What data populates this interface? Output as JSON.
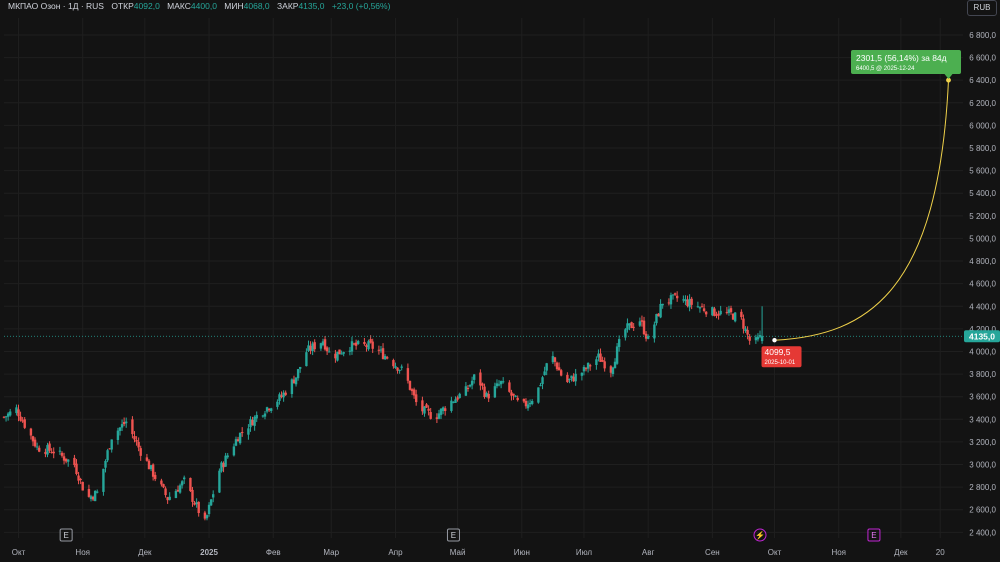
{
  "header": {
    "symbol": "МКПАО Озон · 1Д · RUS",
    "open_label": "ОТКР",
    "open_value": "4092,0",
    "high_label": "МАКС",
    "high_value": "4400,0",
    "low_label": "МИН",
    "low_value": "4068,0",
    "close_label": "ЗАКР",
    "close_value": "4135,0",
    "change": "+23,0 (+0,56%)"
  },
  "currency_button": "RUB",
  "current_price_label": "4135,0",
  "projection": {
    "start_label": "4099,5",
    "start_date": "2025-10-01",
    "target_label": "2301,5 (56,14%) за 84д",
    "target_sub": "6400,5 @ 2025-12-24"
  },
  "event_markers": [
    {
      "label": "E",
      "x": "2024-10-24"
    },
    {
      "label": "E",
      "x": "2025-04-29"
    },
    {
      "label": "⚡",
      "x": "2025-09-24"
    },
    {
      "label": "E",
      "x": "2025-11-18"
    }
  ],
  "colors": {
    "background": "#131313",
    "up": "#26a69a",
    "down": "#ef5350",
    "projection_line": "#f0d24a",
    "target_badge": "#4caf50",
    "start_badge": "#e53935",
    "price_line": "#26a69a"
  },
  "chart_data": {
    "type": "candlestick",
    "title": "МКПАО Озон · 1Д · RUS",
    "y_unit": "RUB",
    "ylim": [
      2350,
      6950
    ],
    "xlim": [
      "2024-09-24",
      "2025-12-31"
    ],
    "y_ticks": [
      "2 400,0",
      "2 600,0",
      "2 800,0",
      "3 000,0",
      "3 200,0",
      "3 400,0",
      "3 600,0",
      "3 800,0",
      "4 000,0",
      "4 200,0",
      "4 400,0",
      "4 600,0",
      "4 800,0",
      "5 000,0",
      "5 200,0",
      "5 400,0",
      "5 600,0",
      "5 800,0",
      "6 000,0",
      "6 200,0",
      "6 400,0",
      "6 600,0",
      "6 800,0"
    ],
    "x_ticks": [
      {
        "label": "Окт",
        "date": "2024-10-01"
      },
      {
        "label": "Ноя",
        "date": "2024-11-01"
      },
      {
        "label": "Дек",
        "date": "2024-12-01"
      },
      {
        "label": "2025",
        "date": "2025-01-01"
      },
      {
        "label": "Фев",
        "date": "2025-02-01"
      },
      {
        "label": "Мар",
        "date": "2025-03-01"
      },
      {
        "label": "Апр",
        "date": "2025-04-01"
      },
      {
        "label": "Май",
        "date": "2025-05-01"
      },
      {
        "label": "Июн",
        "date": "2025-06-01"
      },
      {
        "label": "Июл",
        "date": "2025-07-01"
      },
      {
        "label": "Авг",
        "date": "2025-08-01"
      },
      {
        "label": "Сен",
        "date": "2025-09-01"
      },
      {
        "label": "Окт",
        "date": "2025-10-01"
      },
      {
        "label": "Ноя",
        "date": "2025-11-01"
      },
      {
        "label": "Дек",
        "date": "2025-12-01"
      },
      {
        "label": "20",
        "date": "2025-12-20"
      }
    ],
    "anchors": [
      {
        "date": "2024-09-24",
        "close": 3420
      },
      {
        "date": "2024-09-30",
        "close": 3490
      },
      {
        "date": "2024-10-10",
        "close": 3150
      },
      {
        "date": "2024-10-18",
        "close": 3120
      },
      {
        "date": "2024-10-28",
        "close": 3000
      },
      {
        "date": "2024-11-03",
        "close": 2700
      },
      {
        "date": "2024-11-08",
        "close": 2750
      },
      {
        "date": "2024-11-15",
        "close": 3250
      },
      {
        "date": "2024-11-22",
        "close": 3380
      },
      {
        "date": "2024-11-28",
        "close": 3150
      },
      {
        "date": "2024-12-05",
        "close": 2920
      },
      {
        "date": "2024-12-12",
        "close": 2700
      },
      {
        "date": "2024-12-20",
        "close": 2850
      },
      {
        "date": "2024-12-30",
        "close": 2480
      },
      {
        "date": "2025-01-06",
        "close": 2950
      },
      {
        "date": "2025-01-15",
        "close": 3250
      },
      {
        "date": "2025-01-25",
        "close": 3450
      },
      {
        "date": "2025-02-05",
        "close": 3600
      },
      {
        "date": "2025-02-12",
        "close": 3780
      },
      {
        "date": "2025-02-17",
        "close": 4000
      },
      {
        "date": "2025-02-25",
        "close": 4100
      },
      {
        "date": "2025-03-01",
        "close": 3950
      },
      {
        "date": "2025-03-10",
        "close": 4050
      },
      {
        "date": "2025-03-20",
        "close": 4050
      },
      {
        "date": "2025-03-28",
        "close": 3950
      },
      {
        "date": "2025-04-05",
        "close": 3820
      },
      {
        "date": "2025-04-12",
        "close": 3500
      },
      {
        "date": "2025-04-20",
        "close": 3420
      },
      {
        "date": "2025-04-28",
        "close": 3560
      },
      {
        "date": "2025-05-05",
        "close": 3650
      },
      {
        "date": "2025-05-10",
        "close": 3800
      },
      {
        "date": "2025-05-15",
        "close": 3600
      },
      {
        "date": "2025-05-22",
        "close": 3720
      },
      {
        "date": "2025-06-01",
        "close": 3500
      },
      {
        "date": "2025-06-08",
        "close": 3620
      },
      {
        "date": "2025-06-15",
        "close": 3980
      },
      {
        "date": "2025-06-22",
        "close": 3720
      },
      {
        "date": "2025-07-01",
        "close": 3830
      },
      {
        "date": "2025-07-08",
        "close": 3950
      },
      {
        "date": "2025-07-14",
        "close": 3840
      },
      {
        "date": "2025-07-20",
        "close": 4180
      },
      {
        "date": "2025-07-28",
        "close": 4280
      },
      {
        "date": "2025-08-01",
        "close": 4100
      },
      {
        "date": "2025-08-08",
        "close": 4440
      },
      {
        "date": "2025-08-15",
        "close": 4470
      },
      {
        "date": "2025-08-25",
        "close": 4400
      },
      {
        "date": "2025-09-01",
        "close": 4350
      },
      {
        "date": "2025-09-10",
        "close": 4330
      },
      {
        "date": "2025-09-15",
        "close": 4280
      },
      {
        "date": "2025-09-20",
        "close": 4050
      },
      {
        "date": "2025-09-25",
        "close": 4135
      }
    ],
    "last_candle": {
      "date": "2025-09-25",
      "open": 4092.0,
      "high": 4400.0,
      "low": 4068.0,
      "close": 4135.0
    },
    "projection": {
      "start_date": "2025-10-01",
      "start_value": 4099.5,
      "end_date": "2025-12-24",
      "end_value": 6400.5,
      "change": 2301.5,
      "change_pct": 56.14,
      "days": 84
    }
  }
}
